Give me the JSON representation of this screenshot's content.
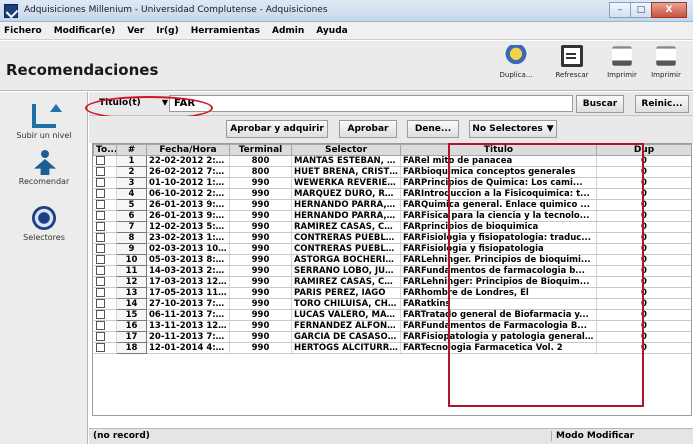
{
  "window": {
    "title": "Adquisiciones Millenium - Universidad Complutense - Adquisiciones",
    "buttons": {
      "minimize": "–",
      "maximize": "□",
      "close": "X"
    }
  },
  "menu": [
    "Fichero",
    "Modificar(e)",
    "Ver",
    "Ir(g)",
    "Herramientas",
    "Admin",
    "Ayuda"
  ],
  "header": {
    "title": "Recomendaciones",
    "toolbar": [
      {
        "label": "Duplica...",
        "icon": "duplicate-icon"
      },
      {
        "label": "Refrescar",
        "icon": "refresh-icon"
      },
      {
        "label": "Imprimir",
        "icon": "print-icon"
      },
      {
        "label": "Imprimir",
        "icon": "print-icon"
      }
    ]
  },
  "sidebar": [
    {
      "label": "Subir un nivel",
      "icon": "up-level-icon"
    },
    {
      "label": "Recomendar",
      "icon": "recommend-icon"
    },
    {
      "label": "Selectores",
      "icon": "selectors-icon"
    }
  ],
  "search": {
    "field": "Titulo(t)",
    "value": "FAR",
    "search_button": "Buscar",
    "reset_button": "Reinic..."
  },
  "actions": {
    "approve_and_acquire": "Aprobar y adquirir",
    "approve": "Aprobar",
    "deny": "Dene...",
    "selectors_filter": "No Selectores"
  },
  "table": {
    "columns": [
      "To...",
      "#",
      "Fecha/Hora",
      "Terminal",
      "Selector",
      "Titulo",
      "Dup"
    ],
    "rows": [
      {
        "n": "1",
        "date": "22-02-2012 2:33PM",
        "terminal": "800",
        "selector": "MANTAS ESTEBAN, A...",
        "prefix": "FAR",
        "title": "el mito de panacea",
        "dup": "0"
      },
      {
        "n": "2",
        "date": "26-02-2012 7:41PM",
        "terminal": "800",
        "selector": "HUET BREÑA, CRISTINA",
        "prefix": "FAR",
        "title": "bioquimica conceptos generales",
        "dup": "0"
      },
      {
        "n": "3",
        "date": "01-10-2012 1:28PM",
        "terminal": "990",
        "selector": "WEWERKA REVERIEG...",
        "prefix": "FAR",
        "title": "Principios de Quimica: Los cami...",
        "dup": "0"
      },
      {
        "n": "4",
        "date": "06-10-2012 2:01PM",
        "terminal": "990",
        "selector": "MARQUEZ DURO, RAQ...",
        "prefix": "FAR",
        "title": "Introduccion a la Fisicoquimica: t...",
        "dup": "0"
      },
      {
        "n": "5",
        "date": "26-01-2013 9:32PM",
        "terminal": "990",
        "selector": "HERNANDO PARRA, C...",
        "prefix": "FAR",
        "title": "Quimica general. Enlace quimico ...",
        "dup": "0"
      },
      {
        "n": "6",
        "date": "26-01-2013 9:33PM",
        "terminal": "990",
        "selector": "HERNANDO PARRA, C...",
        "prefix": "FAR",
        "title": "Fisica para la ciencia y la tecnolo...",
        "dup": "0"
      },
      {
        "n": "7",
        "date": "12-02-2013 5:18PM",
        "terminal": "990",
        "selector": "RAMIREZ CASAS, CAR...",
        "prefix": "FAR",
        "title": "principios de bioquimica",
        "dup": "0"
      },
      {
        "n": "8",
        "date": "23-02-2013 1:11PM",
        "terminal": "990",
        "selector": "CONTRERAS PUEBLA, ...",
        "prefix": "FAR",
        "title": "Fisiologia y fisiopatologia: traduc...",
        "dup": "0"
      },
      {
        "n": "9",
        "date": "02-03-2013 10:51AM",
        "terminal": "990",
        "selector": "CONTRERAS PUEBLA, ...",
        "prefix": "FAR",
        "title": "Fisiologia y fisiopatologia",
        "dup": "0"
      },
      {
        "n": "10",
        "date": "05-03-2013 8:07AM",
        "terminal": "990",
        "selector": "ASTORGA BOCHERINI,...",
        "prefix": "FAR",
        "title": "Lehninger. Principios de bioquimi...",
        "dup": "0"
      },
      {
        "n": "11",
        "date": "14-03-2013 2:43PM",
        "terminal": "990",
        "selector": "SERRANO LOBO, JULIA",
        "prefix": "FAR",
        "title": "Fundamentos de farmacologia b...",
        "dup": "0"
      },
      {
        "n": "12",
        "date": "17-03-2013 12:40PM",
        "terminal": "990",
        "selector": "RAMIREZ CASAS, CAR...",
        "prefix": "FAR",
        "title": "Lehninger: Principios de Bioquim...",
        "dup": "0"
      },
      {
        "n": "13",
        "date": "17-05-2013 11:48AM",
        "terminal": "990",
        "selector": "PARIS PEREZ, IAGO",
        "prefix": "FAR",
        "title": "hombre de Londres, El",
        "dup": "0"
      },
      {
        "n": "14",
        "date": "27-10-2013 7:20PM",
        "terminal": "990",
        "selector": "TORO CHILUISA, CHRI...",
        "prefix": "FAR",
        "title": "atkins",
        "dup": "0"
      },
      {
        "n": "15",
        "date": "06-11-2013 7:32PM",
        "terminal": "990",
        "selector": "LUCAS VALERO, MAR...",
        "prefix": "FAR",
        "title": "Tratado general de Biofarmacia y...",
        "dup": "0"
      },
      {
        "n": "16",
        "date": "13-11-2013 12:54PM",
        "terminal": "990",
        "selector": "FERNÁNDEZ ALFONSO...",
        "prefix": "FAR",
        "title": "Fundamentos de Farmacologia B...",
        "dup": "0"
      },
      {
        "n": "17",
        "date": "20-11-2013 7:53AM",
        "terminal": "990",
        "selector": "GARCIA DE CASASOL...",
        "prefix": "FAR",
        "title": "Fisiopatologia y patologia general...",
        "dup": "0"
      },
      {
        "n": "18",
        "date": "12-01-2014 4:27PM",
        "terminal": "990",
        "selector": "HERTOGS ALCITURRI, ...",
        "prefix": "FAR",
        "title": "Tecnologia Farmacetica Vol. 2",
        "dup": "0"
      }
    ]
  },
  "status": {
    "record": "(no record)",
    "mode": "Modo Modificar"
  },
  "colors": {
    "highlight_red": "#d2162a",
    "title_box_red": "#b0162b"
  }
}
